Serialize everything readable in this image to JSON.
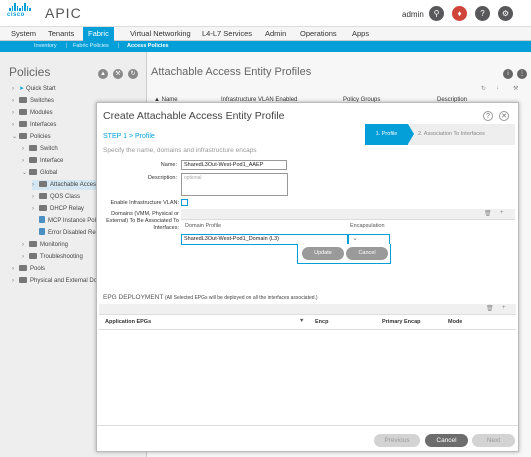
{
  "header": {
    "logo_text": "cisco",
    "app_title": "APIC",
    "user": "admin",
    "icons": [
      "search-icon",
      "bell-icon",
      "help-icon",
      "settings-icon"
    ]
  },
  "nav": {
    "tabs": [
      "System",
      "Tenants",
      "Fabric",
      "Virtual Networking",
      "L4-L7 Services",
      "Admin",
      "Operations",
      "Apps"
    ],
    "active_tab": "Fabric",
    "subtabs": [
      "Inventory",
      "Fabric Policies",
      "Access Policies"
    ],
    "active_subtab": "Access Policies"
  },
  "sidebar": {
    "title": "Policies",
    "items": [
      {
        "label": "Quick Start",
        "type": "quickstart"
      },
      {
        "label": "Switches",
        "type": "folder"
      },
      {
        "label": "Modules",
        "type": "folder"
      },
      {
        "label": "Interfaces",
        "type": "folder"
      },
      {
        "label": "Policies",
        "type": "folder"
      },
      {
        "label": "Switch",
        "type": "folder"
      },
      {
        "label": "Interface",
        "type": "folder"
      },
      {
        "label": "Global",
        "type": "folder"
      },
      {
        "label": "Attachable Access",
        "type": "folder"
      },
      {
        "label": "QOS Class",
        "type": "folder"
      },
      {
        "label": "DHCP Relay",
        "type": "folder"
      },
      {
        "label": "MCP Instance Poli",
        "type": "doc"
      },
      {
        "label": "Error Disabled Rec",
        "type": "doc"
      },
      {
        "label": "Monitoring",
        "type": "folder"
      },
      {
        "label": "Troubleshooting",
        "type": "folder"
      },
      {
        "label": "Pools",
        "type": "folder"
      },
      {
        "label": "Physical and External Do",
        "type": "folder"
      }
    ]
  },
  "main": {
    "title": "Attachable Access Entity Profiles",
    "columns": [
      "Name",
      "Infrastructure VLAN Enabled",
      "Policy Groups",
      "Description"
    ]
  },
  "modal": {
    "title": "Create Attachable Access Entity Profile",
    "steps": [
      "1. Profile",
      "2. Association To Interfaces"
    ],
    "step_label": "STEP 1 > Profile",
    "subtitle": "Specify the name, domains and infrastructure encaps",
    "name_label": "Name:",
    "name_value": "SharedL3Out-West-Pod1_AAEP",
    "description_label": "Description:",
    "description_placeholder": "optional",
    "infra_vlan_label": "Enable Infrastructure VLAN:",
    "domains_label": "Domains (VMM, Physical or External) To Be Associated To Interfaces:",
    "domain_columns": [
      "Domain Profile",
      "Encapsulation"
    ],
    "domain_value": "SharedL3Out-West-Pod1_Domain (L3)",
    "update_label": "Update",
    "cancel_row_label": "Cancel",
    "epg_title": "EPG DEPLOYMENT",
    "epg_note": "(All Selected EPGs will be deployed on all the interfaces associated.)",
    "epg_columns": [
      "Application EPGs",
      "Encp",
      "Primary Encap",
      "Mode"
    ],
    "buttons": {
      "previous": "Previous",
      "cancel": "Cancel",
      "next": "Next"
    }
  },
  "colors": {
    "accent": "#049fd9",
    "nav_bg": "#f5f5f5",
    "sidebar_bg": "#eeeeee",
    "button_gray": "#9a9a9a",
    "button_dark": "#6d6d6d"
  }
}
